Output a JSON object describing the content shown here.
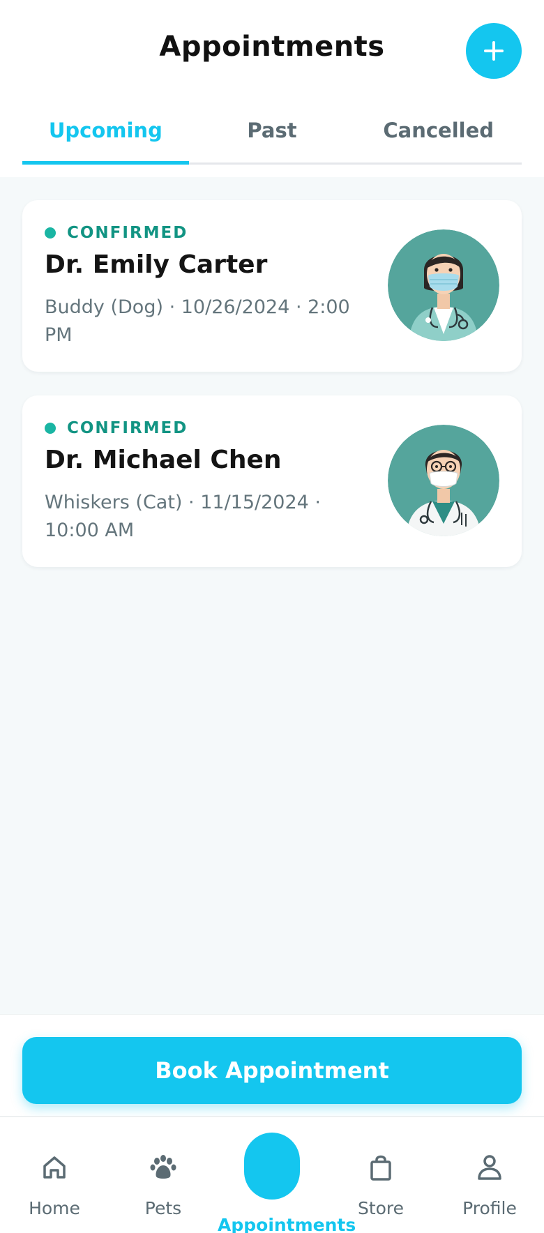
{
  "header": {
    "title": "Appointments",
    "add_icon": "plus-icon"
  },
  "tabs": [
    {
      "label": "Upcoming",
      "active": true
    },
    {
      "label": "Past",
      "active": false
    },
    {
      "label": "Cancelled",
      "active": false
    }
  ],
  "appointments": [
    {
      "status": "CONFIRMED",
      "doctor": "Dr. Emily Carter",
      "details": "Buddy (Dog) · 10/26/2024 · 2:00 PM",
      "avatar_icon": "doctor-avatar-female-mask"
    },
    {
      "status": "CONFIRMED",
      "doctor": "Dr. Michael Chen",
      "details": "Whiskers (Cat) · 11/15/2024 · 10:00 AM",
      "avatar_icon": "doctor-avatar-glasses-mask"
    }
  ],
  "book_button": {
    "label": "Book Appointment"
  },
  "nav": [
    {
      "label": "Home",
      "icon": "home-icon"
    },
    {
      "label": "Pets",
      "icon": "paw-icon"
    },
    {
      "label": "Appointments",
      "icon": "calendar-icon",
      "active": true
    },
    {
      "label": "Store",
      "icon": "shopping-bag-icon"
    },
    {
      "label": "Profile",
      "icon": "user-icon"
    }
  ],
  "colors": {
    "accent": "#14c6ef",
    "status_green": "#129483",
    "avatar_bg": "#4fa39b",
    "text_muted": "#64757c"
  }
}
